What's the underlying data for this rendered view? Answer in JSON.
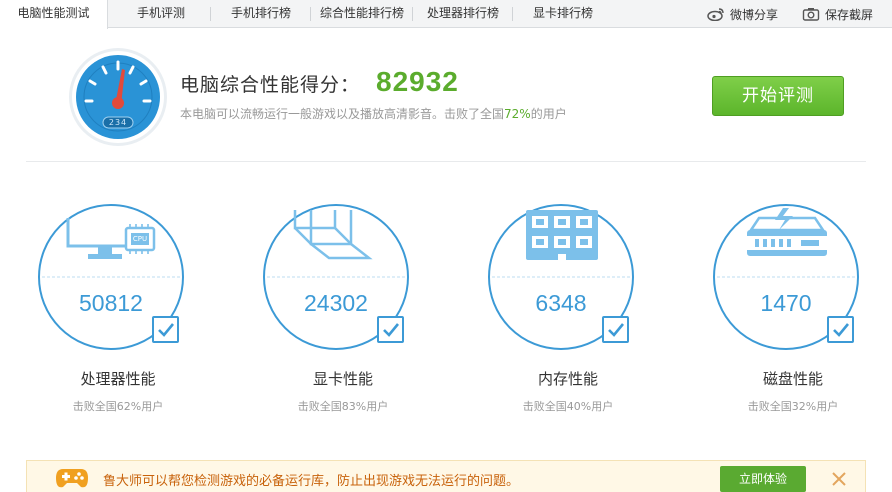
{
  "tabs": [
    {
      "label": "电脑性能测试",
      "active": true
    },
    {
      "label": "手机评测"
    },
    {
      "label": "手机排行榜"
    },
    {
      "label": "综合性能排行榜"
    },
    {
      "label": "处理器排行榜"
    },
    {
      "label": "显卡排行榜"
    }
  ],
  "toolbar": {
    "weibo_label": "微博分享",
    "screenshot_label": "保存截屏"
  },
  "header": {
    "gauge_display": "234",
    "score_title": "电脑综合性能得分：",
    "score_value": "82932",
    "desc_prefix": "本电脑可以流畅运行一般游戏以及播放高清影音。击败了全国",
    "desc_percent": "72%",
    "desc_suffix": "的用户",
    "start_button": "开始评测"
  },
  "cards": [
    {
      "value": "50812",
      "title": "处理器性能",
      "sub": "击败全国62%用户",
      "icon": "cpu-monitor-icon",
      "chip_text": "CPU"
    },
    {
      "value": "24302",
      "title": "显卡性能",
      "sub": "击败全国83%用户",
      "icon": "gpu-cube-icon"
    },
    {
      "value": "6348",
      "title": "内存性能",
      "sub": "击败全国40%用户",
      "icon": "memory-chip-icon"
    },
    {
      "value": "1470",
      "title": "磁盘性能",
      "sub": "击败全国32%用户",
      "icon": "disk-drive-icon"
    }
  ],
  "notice": {
    "text": "鲁大师可以帮您检测游戏的必备运行库，防止出现游戏无法运行的问题。",
    "button": "立即体验"
  },
  "colors": {
    "accent_blue": "#3c9ad6",
    "score_green": "#5bac2d",
    "notice_orange": "#c8620b"
  }
}
